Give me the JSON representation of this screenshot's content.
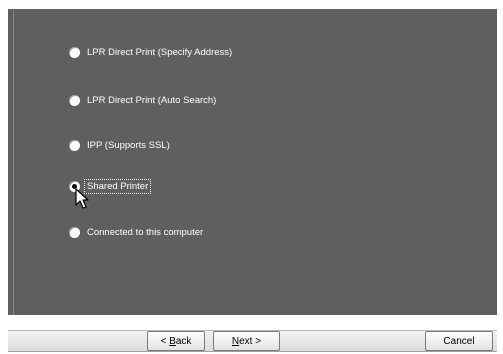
{
  "options": [
    {
      "label": "LPR Direct Print (Specify Address)",
      "checked": false
    },
    {
      "label": "LPR Direct Print (Auto Search)",
      "checked": false
    },
    {
      "label": "IPP (Supports SSL)",
      "checked": false
    },
    {
      "label": "Shared Printer",
      "checked": true
    },
    {
      "label": "Connected to this computer",
      "checked": false
    }
  ],
  "buttons": {
    "back": {
      "prefix": "< ",
      "accel": "B",
      "rest": "ack"
    },
    "next": {
      "accel": "N",
      "rest": "ext >"
    },
    "cancel": "Cancel"
  },
  "colors": {
    "panel": "#5f5f5f",
    "footer": "#e6e6e6"
  }
}
